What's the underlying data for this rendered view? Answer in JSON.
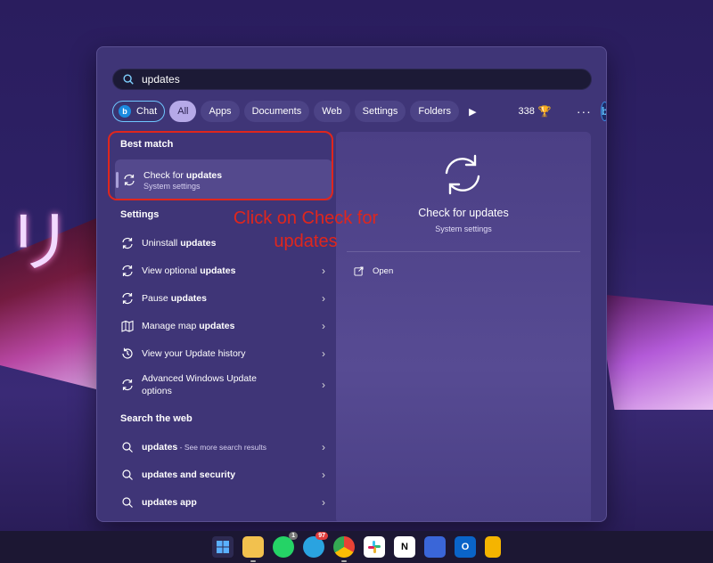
{
  "search": {
    "value": "updates"
  },
  "filters": {
    "chat": "Chat",
    "all": "All",
    "apps": "Apps",
    "documents": "Documents",
    "web": "Web",
    "settings": "Settings",
    "folders": "Folders",
    "points": "338"
  },
  "best_match": {
    "heading": "Best match",
    "title_prefix": "Check for ",
    "title_bold": "updates",
    "subtitle": "System settings"
  },
  "settings_section": {
    "heading": "Settings",
    "items": [
      {
        "prefix": "Uninstall ",
        "bold": "updates",
        "chevron": false
      },
      {
        "prefix": "View optional ",
        "bold": "updates",
        "chevron": true
      },
      {
        "prefix": "Pause ",
        "bold": "updates",
        "chevron": true
      },
      {
        "prefix": "Manage map ",
        "bold": "updates",
        "chevron": true
      },
      {
        "prefix": "View your Update history",
        "bold": "",
        "chevron": true
      },
      {
        "prefix": "Advanced Windows Update options",
        "bold": "",
        "chevron": true
      }
    ]
  },
  "web_section": {
    "heading": "Search the web",
    "items": [
      {
        "bold": "updates",
        "suffix": " - See more search results"
      },
      {
        "bold": "updates and security",
        "suffix": ""
      },
      {
        "bold": "updates app",
        "suffix": ""
      }
    ]
  },
  "detail": {
    "title": "Check for updates",
    "subtitle": "System settings",
    "open_label": "Open"
  },
  "annotation": {
    "text": "Click on Check for updates",
    "color": "#e0261d"
  },
  "taskbar": {
    "whatsapp_badge": "1",
    "telegram_badge": "97"
  },
  "colors": {
    "panel": "#3f3577",
    "accent": "#6fc6ff",
    "annotation": "#e0261d"
  }
}
